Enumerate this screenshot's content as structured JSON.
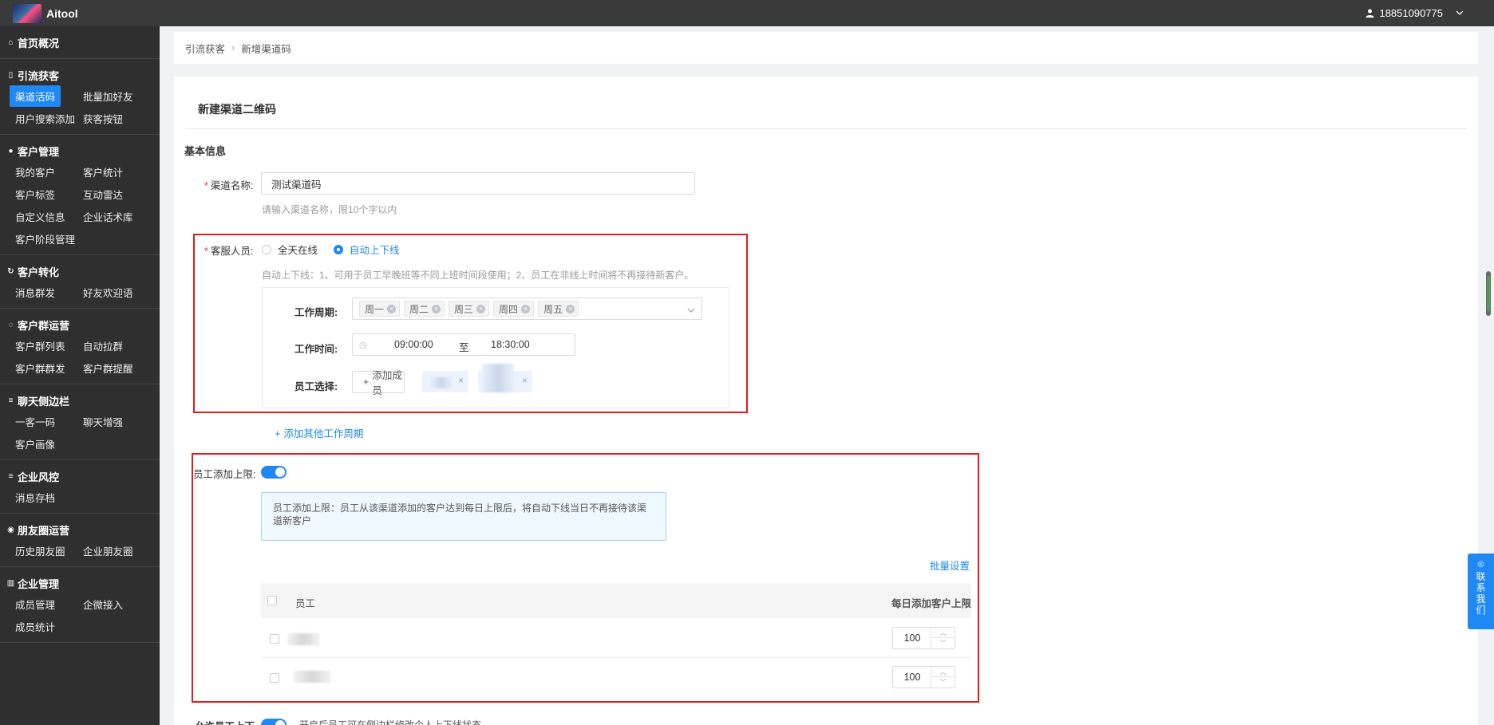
{
  "app": {
    "name": "Aitool"
  },
  "user": {
    "phone": "18851090775"
  },
  "sidebar": {
    "groups": [
      {
        "title": "首页概况",
        "icon": "home-icon",
        "items": []
      },
      {
        "title": "引流获客",
        "icon": "bookmark-icon",
        "items": [
          "渠道活码",
          "批量加好友",
          "用户搜索添加",
          "获客按钮"
        ],
        "active": "渠道活码"
      },
      {
        "title": "客户管理",
        "icon": "user-icon",
        "items": [
          "我的客户",
          "客户统计",
          "客户标签",
          "互动雷达",
          "自定义信息",
          "企业话术库",
          "客户阶段管理"
        ]
      },
      {
        "title": "客户转化",
        "icon": "refresh-icon",
        "items": [
          "消息群发",
          "好友欢迎语"
        ]
      },
      {
        "title": "客户群运营",
        "icon": "chat-icon",
        "items": [
          "客户群列表",
          "自动拉群",
          "客户群群发",
          "客户群提醒"
        ]
      },
      {
        "title": "聊天侧边栏",
        "icon": "menu-icon",
        "items": [
          "一客一码",
          "聊天增强",
          "客户画像"
        ]
      },
      {
        "title": "企业风控",
        "icon": "menu-icon",
        "items": [
          "消息存档"
        ]
      },
      {
        "title": "朋友圈运营",
        "icon": "camera-icon",
        "items": [
          "历史朋友圈",
          "企业朋友圈"
        ]
      },
      {
        "title": "企业管理",
        "icon": "building-icon",
        "items": [
          "成员管理",
          "企微接入",
          "成员统计"
        ]
      }
    ]
  },
  "breadcrumb": {
    "parent": "引流获客",
    "current": "新增渠道码"
  },
  "form": {
    "title": "新建渠道二维码",
    "section": "基本信息",
    "channel_name": {
      "label": "渠道名称:",
      "value": "测试渠道码",
      "hint": "请输入渠道名称，限10个字以内"
    },
    "service": {
      "label": "客服人员:",
      "option_all": "全天在线",
      "option_auto": "自动上下线",
      "selected": "自动上下线",
      "hint": "自动上下线：1、可用于员工早晚班等不同上班时间段使用；2、员工在非线上时间将不再接待新客户。",
      "period_label": "工作周期:",
      "days": [
        "周一",
        "周二",
        "周三",
        "周四",
        "周五"
      ],
      "time_label": "工作时间:",
      "time_start": "09:00:00",
      "time_sep": "至",
      "time_end": "18:30:00",
      "staff_label": "员工选择:",
      "add_member": "添加成员",
      "add_period": "添加其他工作周期"
    },
    "limit": {
      "label": "员工添加上限:",
      "enabled": true,
      "info": "员工添加上限：员工从该渠道添加的客户达到每日上限后，将自动下线当日不再接待该渠道新客户",
      "batch": "批量设置",
      "col_staff": "员工",
      "col_limit": "每日添加客户上限",
      "rows": [
        {
          "limit": "100"
        },
        {
          "limit": "100"
        }
      ]
    },
    "allow": {
      "label": "允许员工上下",
      "hint": "开启后员工可在侧边栏修改个人上下线状态"
    }
  },
  "contact": {
    "label": "联系我们"
  }
}
